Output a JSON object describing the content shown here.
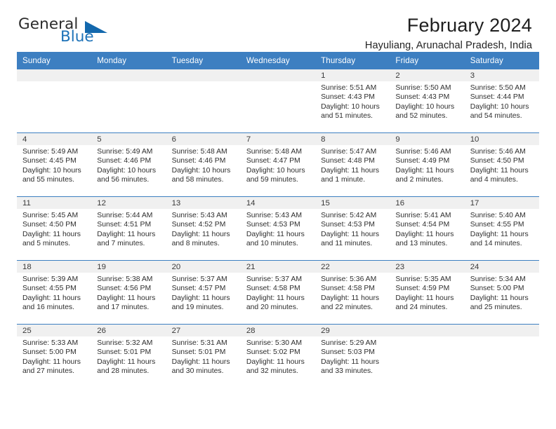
{
  "brand": {
    "name_top": "General",
    "name_bottom": "Blue"
  },
  "header": {
    "month_title": "February 2024",
    "location": "Hayuliang, Arunachal Pradesh, India"
  },
  "colors": {
    "header_blue": "#3d7fc1",
    "brand_blue": "#1d72b8",
    "daynum_band": "#f0f0f0"
  },
  "calendar": {
    "weekday_headers": [
      "Sunday",
      "Monday",
      "Tuesday",
      "Wednesday",
      "Thursday",
      "Friday",
      "Saturday"
    ],
    "labels": {
      "sunrise": "Sunrise:",
      "sunset": "Sunset:",
      "daylight": "Daylight:"
    },
    "weeks": [
      [
        {
          "day": "",
          "empty": true
        },
        {
          "day": "",
          "empty": true
        },
        {
          "day": "",
          "empty": true
        },
        {
          "day": "",
          "empty": true
        },
        {
          "day": "1",
          "sunrise": "Sunrise: 5:51 AM",
          "sunset": "Sunset: 4:43 PM",
          "daylight_1": "Daylight: 10 hours",
          "daylight_2": "and 51 minutes."
        },
        {
          "day": "2",
          "sunrise": "Sunrise: 5:50 AM",
          "sunset": "Sunset: 4:43 PM",
          "daylight_1": "Daylight: 10 hours",
          "daylight_2": "and 52 minutes."
        },
        {
          "day": "3",
          "sunrise": "Sunrise: 5:50 AM",
          "sunset": "Sunset: 4:44 PM",
          "daylight_1": "Daylight: 10 hours",
          "daylight_2": "and 54 minutes."
        }
      ],
      [
        {
          "day": "4",
          "sunrise": "Sunrise: 5:49 AM",
          "sunset": "Sunset: 4:45 PM",
          "daylight_1": "Daylight: 10 hours",
          "daylight_2": "and 55 minutes."
        },
        {
          "day": "5",
          "sunrise": "Sunrise: 5:49 AM",
          "sunset": "Sunset: 4:46 PM",
          "daylight_1": "Daylight: 10 hours",
          "daylight_2": "and 56 minutes."
        },
        {
          "day": "6",
          "sunrise": "Sunrise: 5:48 AM",
          "sunset": "Sunset: 4:46 PM",
          "daylight_1": "Daylight: 10 hours",
          "daylight_2": "and 58 minutes."
        },
        {
          "day": "7",
          "sunrise": "Sunrise: 5:48 AM",
          "sunset": "Sunset: 4:47 PM",
          "daylight_1": "Daylight: 10 hours",
          "daylight_2": "and 59 minutes."
        },
        {
          "day": "8",
          "sunrise": "Sunrise: 5:47 AM",
          "sunset": "Sunset: 4:48 PM",
          "daylight_1": "Daylight: 11 hours",
          "daylight_2": "and 1 minute."
        },
        {
          "day": "9",
          "sunrise": "Sunrise: 5:46 AM",
          "sunset": "Sunset: 4:49 PM",
          "daylight_1": "Daylight: 11 hours",
          "daylight_2": "and 2 minutes."
        },
        {
          "day": "10",
          "sunrise": "Sunrise: 5:46 AM",
          "sunset": "Sunset: 4:50 PM",
          "daylight_1": "Daylight: 11 hours",
          "daylight_2": "and 4 minutes."
        }
      ],
      [
        {
          "day": "11",
          "sunrise": "Sunrise: 5:45 AM",
          "sunset": "Sunset: 4:50 PM",
          "daylight_1": "Daylight: 11 hours",
          "daylight_2": "and 5 minutes."
        },
        {
          "day": "12",
          "sunrise": "Sunrise: 5:44 AM",
          "sunset": "Sunset: 4:51 PM",
          "daylight_1": "Daylight: 11 hours",
          "daylight_2": "and 7 minutes."
        },
        {
          "day": "13",
          "sunrise": "Sunrise: 5:43 AM",
          "sunset": "Sunset: 4:52 PM",
          "daylight_1": "Daylight: 11 hours",
          "daylight_2": "and 8 minutes."
        },
        {
          "day": "14",
          "sunrise": "Sunrise: 5:43 AM",
          "sunset": "Sunset: 4:53 PM",
          "daylight_1": "Daylight: 11 hours",
          "daylight_2": "and 10 minutes."
        },
        {
          "day": "15",
          "sunrise": "Sunrise: 5:42 AM",
          "sunset": "Sunset: 4:53 PM",
          "daylight_1": "Daylight: 11 hours",
          "daylight_2": "and 11 minutes."
        },
        {
          "day": "16",
          "sunrise": "Sunrise: 5:41 AM",
          "sunset": "Sunset: 4:54 PM",
          "daylight_1": "Daylight: 11 hours",
          "daylight_2": "and 13 minutes."
        },
        {
          "day": "17",
          "sunrise": "Sunrise: 5:40 AM",
          "sunset": "Sunset: 4:55 PM",
          "daylight_1": "Daylight: 11 hours",
          "daylight_2": "and 14 minutes."
        }
      ],
      [
        {
          "day": "18",
          "sunrise": "Sunrise: 5:39 AM",
          "sunset": "Sunset: 4:55 PM",
          "daylight_1": "Daylight: 11 hours",
          "daylight_2": "and 16 minutes."
        },
        {
          "day": "19",
          "sunrise": "Sunrise: 5:38 AM",
          "sunset": "Sunset: 4:56 PM",
          "daylight_1": "Daylight: 11 hours",
          "daylight_2": "and 17 minutes."
        },
        {
          "day": "20",
          "sunrise": "Sunrise: 5:37 AM",
          "sunset": "Sunset: 4:57 PM",
          "daylight_1": "Daylight: 11 hours",
          "daylight_2": "and 19 minutes."
        },
        {
          "day": "21",
          "sunrise": "Sunrise: 5:37 AM",
          "sunset": "Sunset: 4:58 PM",
          "daylight_1": "Daylight: 11 hours",
          "daylight_2": "and 20 minutes."
        },
        {
          "day": "22",
          "sunrise": "Sunrise: 5:36 AM",
          "sunset": "Sunset: 4:58 PM",
          "daylight_1": "Daylight: 11 hours",
          "daylight_2": "and 22 minutes."
        },
        {
          "day": "23",
          "sunrise": "Sunrise: 5:35 AM",
          "sunset": "Sunset: 4:59 PM",
          "daylight_1": "Daylight: 11 hours",
          "daylight_2": "and 24 minutes."
        },
        {
          "day": "24",
          "sunrise": "Sunrise: 5:34 AM",
          "sunset": "Sunset: 5:00 PM",
          "daylight_1": "Daylight: 11 hours",
          "daylight_2": "and 25 minutes."
        }
      ],
      [
        {
          "day": "25",
          "sunrise": "Sunrise: 5:33 AM",
          "sunset": "Sunset: 5:00 PM",
          "daylight_1": "Daylight: 11 hours",
          "daylight_2": "and 27 minutes."
        },
        {
          "day": "26",
          "sunrise": "Sunrise: 5:32 AM",
          "sunset": "Sunset: 5:01 PM",
          "daylight_1": "Daylight: 11 hours",
          "daylight_2": "and 28 minutes."
        },
        {
          "day": "27",
          "sunrise": "Sunrise: 5:31 AM",
          "sunset": "Sunset: 5:01 PM",
          "daylight_1": "Daylight: 11 hours",
          "daylight_2": "and 30 minutes."
        },
        {
          "day": "28",
          "sunrise": "Sunrise: 5:30 AM",
          "sunset": "Sunset: 5:02 PM",
          "daylight_1": "Daylight: 11 hours",
          "daylight_2": "and 32 minutes."
        },
        {
          "day": "29",
          "sunrise": "Sunrise: 5:29 AM",
          "sunset": "Sunset: 5:03 PM",
          "daylight_1": "Daylight: 11 hours",
          "daylight_2": "and 33 minutes."
        },
        {
          "day": "",
          "empty": true
        },
        {
          "day": "",
          "empty": true
        }
      ]
    ]
  }
}
